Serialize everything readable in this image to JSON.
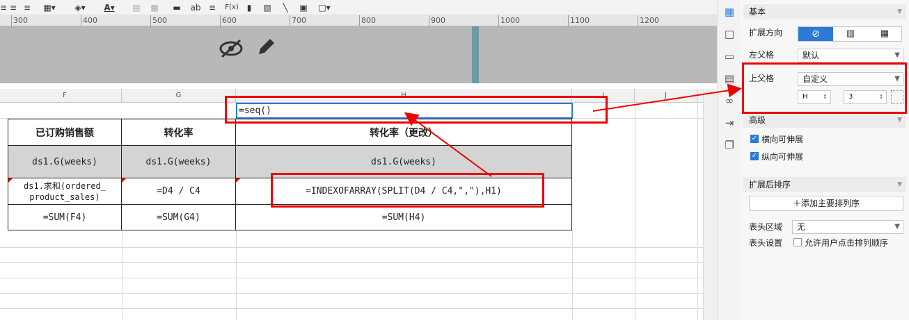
{
  "toolbar": {
    "items": [
      "align-left-icon",
      "align-center-icon",
      "align-right-icon",
      "border-icon",
      "fill-color-icon",
      "font-color-icon",
      "merge-icon",
      "grid-icon",
      "insert-row-icon",
      "text-icon",
      "align-icon",
      "formula-icon",
      "chart-icon",
      "image-icon",
      "slash-icon",
      "subreport-icon",
      "frame-icon"
    ],
    "text_label": "ab",
    "formula_label": "F(x)",
    "font_color_label": "A"
  },
  "ruler": [
    "300",
    "400",
    "500",
    "600",
    "700",
    "800",
    "900",
    "1000",
    "1100",
    "1200"
  ],
  "columns": [
    "F",
    "G",
    "H",
    "I",
    "J"
  ],
  "sheet": {
    "selected_cell": "=seq()",
    "headers": [
      "已订购销售额",
      "转化率",
      "转化率（更改）"
    ],
    "row_group": [
      "ds1.G(weeks)",
      "ds1.G(weeks)",
      "ds1.G(weeks)"
    ],
    "row_data": [
      "ds1.求和(ordered_\nproduct_sales)",
      "=D4 / C4",
      "=INDEXOFARRAY(SPLIT(D4 / C4,\",\"),H1)"
    ],
    "row_sum": [
      "=SUM(F4)",
      "=SUM(G4)",
      "=SUM(H4)"
    ]
  },
  "panel": {
    "section_basic": "基本",
    "expand_dir_label": "扩展方向",
    "left_parent_label": "左父格",
    "left_parent_value": "默认",
    "top_parent_label": "上父格",
    "top_parent_value": "自定义",
    "top_parent_col": "H",
    "top_parent_row": "3",
    "section_advanced": "高级",
    "h_expand_label": "横向可伸展",
    "v_expand_label": "纵向可伸展",
    "section_sort": "扩展后排序",
    "add_sort_label": "添加主要排列序",
    "header_area_label": "表头区域",
    "header_area_value": "无",
    "header_setting_label": "表头设置",
    "allow_sort_label": "允许用户点击排列顺序"
  }
}
